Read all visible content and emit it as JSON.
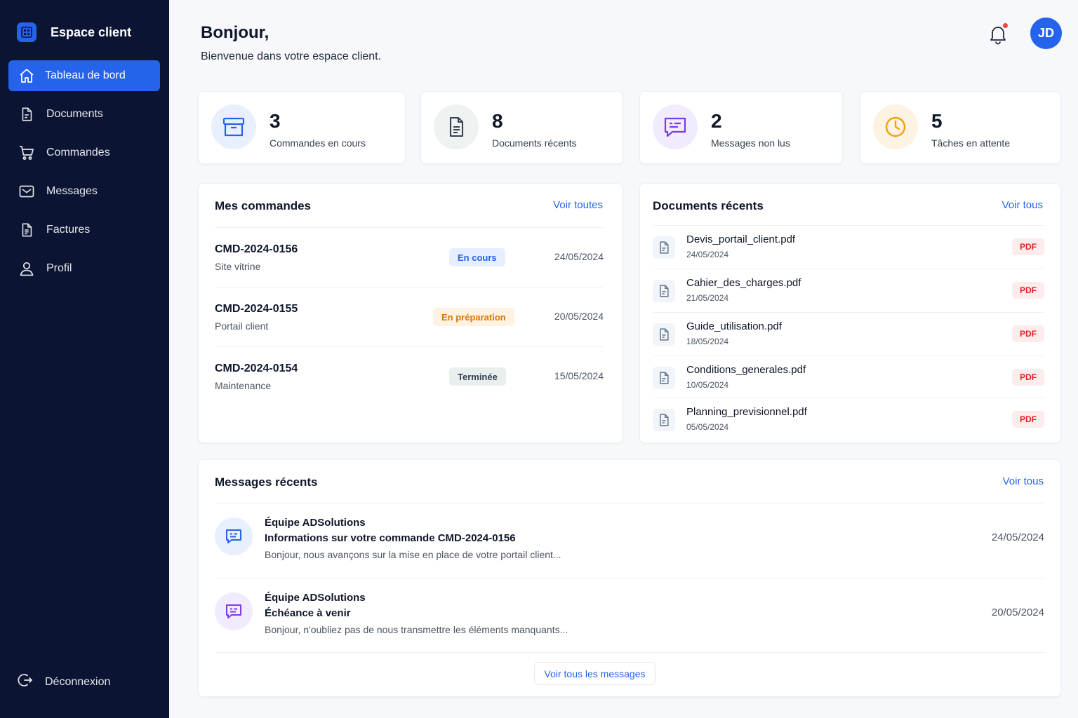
{
  "app": {
    "title": "Espace client"
  },
  "sidebar": {
    "items": [
      {
        "label": "Tableau de bord",
        "icon": "home-icon",
        "active": true
      },
      {
        "label": "Documents",
        "icon": "document-icon"
      },
      {
        "label": "Commandes",
        "icon": "cart-icon"
      },
      {
        "label": "Messages",
        "icon": "mail-icon"
      },
      {
        "label": "Factures",
        "icon": "invoice-icon"
      },
      {
        "label": "Profil",
        "icon": "user-icon"
      }
    ],
    "logout": {
      "label": "Déconnexion",
      "icon": "logout-icon"
    }
  },
  "header": {
    "greeting": "Bonjour,",
    "subtitle": "Bienvenue dans votre espace client.",
    "avatar_initials": "JD",
    "has_notification": true
  },
  "stats": [
    {
      "value": "3",
      "label": "Commandes en cours",
      "icon": "archive-box-icon",
      "color": "#2563eb",
      "bg": "#e8f0fe"
    },
    {
      "value": "8",
      "label": "Documents récents",
      "icon": "file-text-icon",
      "color": "#374151",
      "bg": "#eef2f0"
    },
    {
      "value": "2",
      "label": "Messages non lus",
      "icon": "message-icon",
      "color": "#7c3aed",
      "bg": "#f1ebfd"
    },
    {
      "value": "5",
      "label": "Tâches en attente",
      "icon": "clock-icon",
      "color": "#f59e0b",
      "bg": "#fdf3e2"
    }
  ],
  "orders": {
    "title": "Mes commandes",
    "link": "Voir toutes",
    "rows": [
      {
        "id": "CMD-2024-0156",
        "name": "Site vitrine",
        "status": "En cours",
        "date": "24/05/2024"
      },
      {
        "id": "CMD-2024-0155",
        "name": "Portail client",
        "status": "En préparation",
        "date": "20/05/2024"
      },
      {
        "id": "CMD-2024-0154",
        "name": "Maintenance",
        "status": "Terminée",
        "date": "15/05/2024"
      }
    ]
  },
  "documents": {
    "title": "Documents récents",
    "link": "Voir tous",
    "badge": "PDF",
    "rows": [
      {
        "name": "Devis_portail_client.pdf",
        "date": "24/05/2024"
      },
      {
        "name": "Cahier_des_charges.pdf",
        "date": "21/05/2024"
      },
      {
        "name": "Guide_utilisation.pdf",
        "date": "18/05/2024"
      },
      {
        "name": "Conditions_generales.pdf",
        "date": "10/05/2024"
      },
      {
        "name": "Planning_previsionnel.pdf",
        "date": "05/05/2024"
      }
    ]
  },
  "messages": {
    "title": "Messages récents",
    "link": "Voir tous",
    "all_button": "Voir tous les messages",
    "rows": [
      {
        "from": "Équipe ADSolutions",
        "subject": "Informations sur votre commande CMD-2024-0156",
        "preview": "Bonjour, nous avançons sur la mise en place de votre portail client...",
        "date": "24/05/2024",
        "color": "#2563eb",
        "bg": "#e8f0fe"
      },
      {
        "from": "Équipe ADSolutions",
        "subject": "Échéance à venir",
        "preview": "Bonjour, n'oubliez pas de nous transmettre les éléments manquants...",
        "date": "20/05/2024",
        "color": "#7c3aed",
        "bg": "#f1ebfd"
      }
    ]
  }
}
